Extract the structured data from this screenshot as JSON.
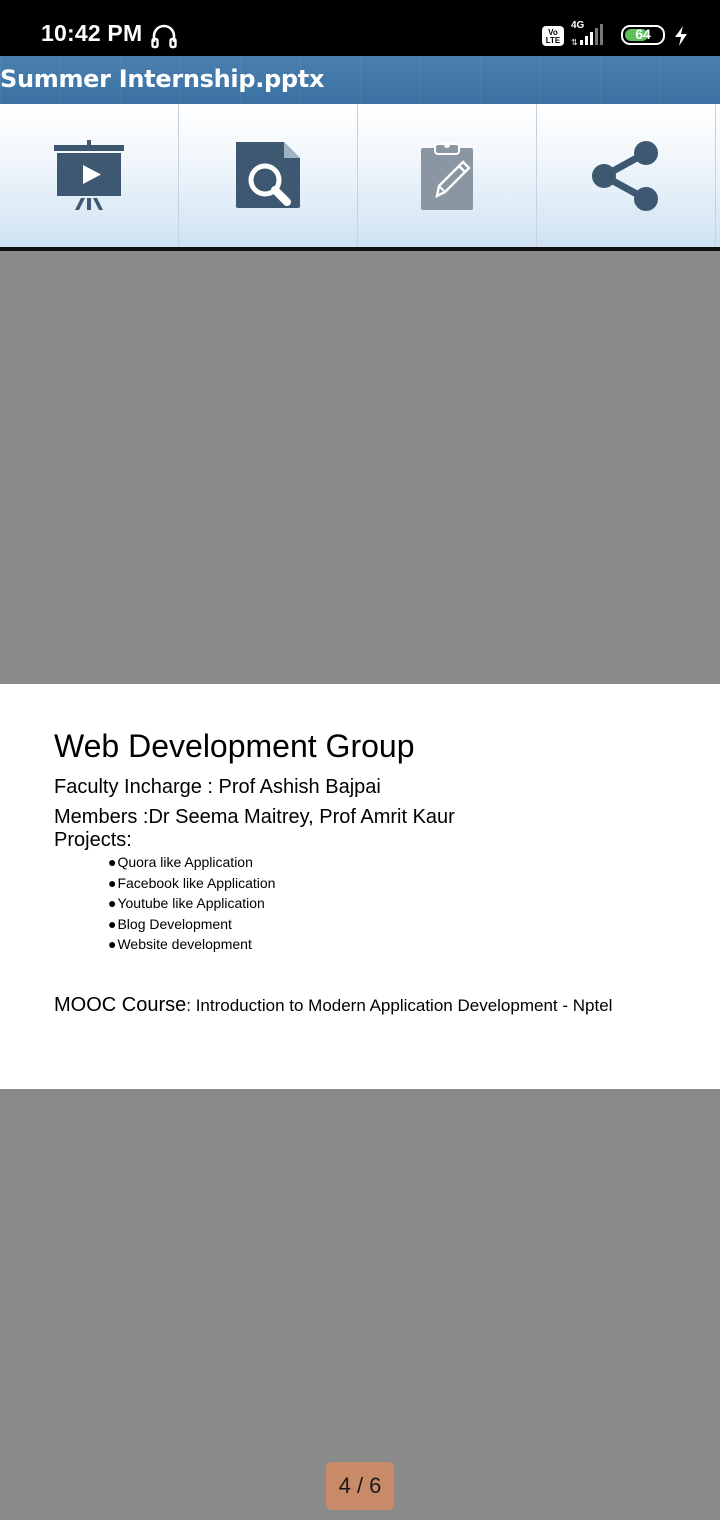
{
  "status_bar": {
    "time": "10:42 PM",
    "headset_icon": "headphones-icon",
    "volte_label": "Vo LTE",
    "network_label": "4G",
    "battery_level": "64",
    "battery_fraction": 0.64,
    "charging_icon": "bolt-icon"
  },
  "titlebar": {
    "title": "Summer Internship.pptx"
  },
  "toolbar": {
    "items": [
      {
        "name": "slideshow",
        "icon": "presentation-play-icon"
      },
      {
        "name": "search",
        "icon": "document-search-icon"
      },
      {
        "name": "edit",
        "icon": "clipboard-edit-icon"
      },
      {
        "name": "share",
        "icon": "share-icon"
      }
    ]
  },
  "slide": {
    "title": "Web Development Group",
    "faculty": "Faculty Incharge : Prof Ashish Bajpai",
    "members": "Members :Dr Seema Maitrey, Prof Amrit Kaur",
    "projects_label": "Projects:",
    "bullet_char": "●",
    "projects": [
      "Quora like Application",
      "Facebook like Application",
      "Youtube like Application",
      "Blog Development",
      "Website development"
    ],
    "mooc_label": "MOOC Course",
    "mooc_value": ": Introduction to Modern Application Development - Nptel"
  },
  "page_indicator": "4 / 6",
  "colors": {
    "titlebar": "#3e74a4",
    "viewer_background": "#8a8a8a",
    "page_indicator_bg": "#c98a68",
    "icon_color": "#3d5870",
    "icon_muted": "#8a96a2",
    "battery_fill": "#5cc15c"
  }
}
